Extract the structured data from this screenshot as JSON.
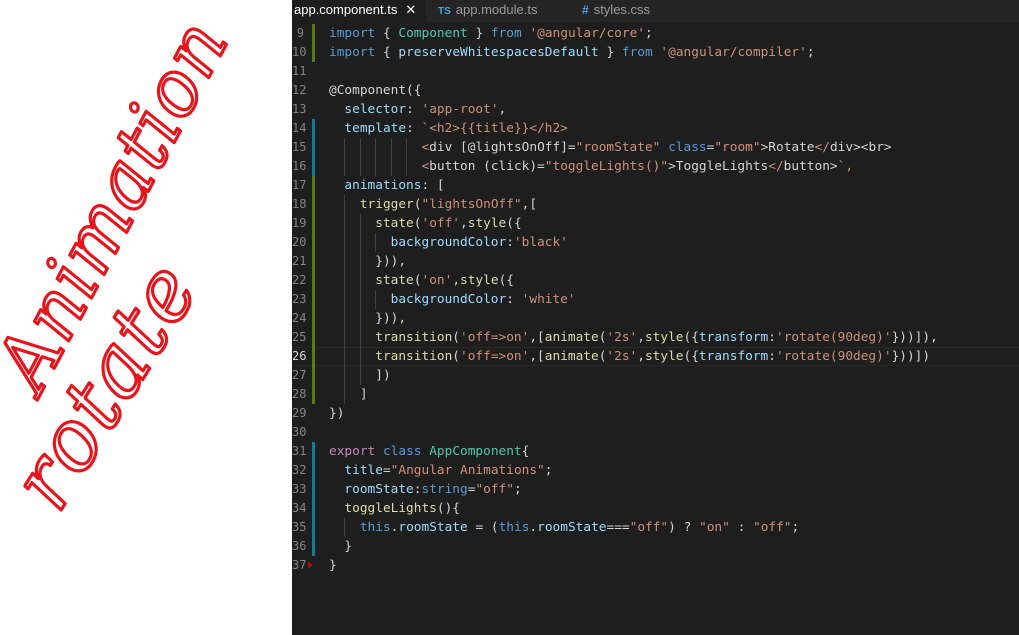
{
  "handwriting": {
    "line1": "Animation",
    "line2": "rotate",
    "color": "#e8141c"
  },
  "tabs": [
    {
      "label": "app.component.ts",
      "prefix": "",
      "active": true,
      "close": "✕"
    },
    {
      "label": "app.module.ts",
      "prefix": "TS",
      "active": false
    },
    {
      "label": "styles.css",
      "prefix": "#",
      "active": false
    }
  ],
  "gutter": {
    "line_numbers": [
      "9",
      "10",
      "11",
      "12",
      "13",
      "14",
      "15",
      "16",
      "17",
      "18",
      "19",
      "20",
      "21",
      "22",
      "23",
      "24",
      "25",
      "26",
      "27",
      "28",
      "29",
      "30",
      "31",
      "32",
      "33",
      "34",
      "35",
      "36",
      "37"
    ],
    "current_line": "26"
  },
  "code": [
    "import { Component } from '@angular/core';",
    "import { preserveWhitespacesDefault } from '@angular/compiler';",
    "",
    "@Component({",
    "  selector: 'app-root',",
    "  template: `<h2>{{title}}</h2>",
    "            <div [@lightsOnOff]=\"roomState\" class=\"room\">Rotate</div><br>",
    "            <button (click)=\"toggleLights()\">ToggleLights</button>`,",
    "  animations: [",
    "    trigger(\"lightsOnOff\",[",
    "      state('off',style({",
    "        backgroundColor:'black'",
    "      })),",
    "      state('on',style({",
    "        backgroundColor: 'white'",
    "      })),",
    "      transition('off=>on',[animate('2s',style({transform:'rotate(90deg)'}))]),",
    "      transition('off=>on',[animate('2s',style({transform:'rotate(90deg)'}))])",
    "      ])",
    "    ]",
    "})",
    "",
    "export class AppComponent{",
    "  title=\"Angular Animations\";",
    "  roomState:string=\"off\";",
    "  toggleLights(){",
    "    this.roomState = (this.roomState===\"off\") ? \"on\" : \"off\";",
    "  }",
    "}"
  ],
  "colors": {
    "editor_bg": "#1e1e1e",
    "tabbar_bg": "#252526",
    "keyword": "#569cd6",
    "control_keyword": "#c586c0",
    "string": "#ce9178",
    "property": "#9cdcfe",
    "function": "#dcdcaa",
    "class": "#4ec9b0",
    "git_added": "#587c0c",
    "git_modified": "#0c7d9d"
  }
}
